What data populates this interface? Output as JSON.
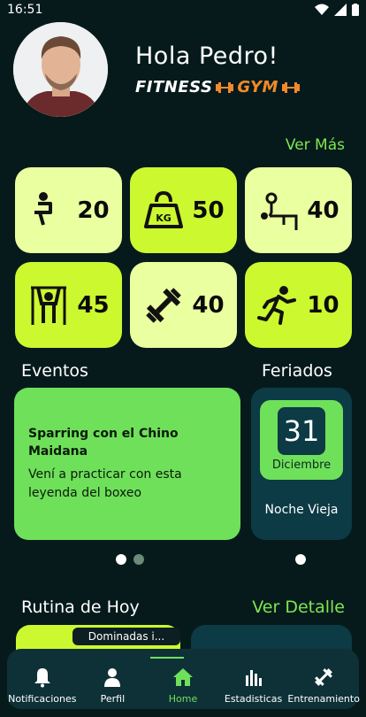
{
  "status_bar": {
    "time": "16:51"
  },
  "header": {
    "greeting": "Hola Pedro!",
    "brand_fitness": "FITNESS",
    "brand_gym": "GYM"
  },
  "stats": {
    "see_more": "Ver Más",
    "items": [
      {
        "icon": "squat-icon",
        "value": "20"
      },
      {
        "icon": "kettlebell-kg-icon",
        "value": "50"
      },
      {
        "icon": "bench-press-icon",
        "value": "40"
      },
      {
        "icon": "pull-up-icon",
        "value": "45"
      },
      {
        "icon": "dumbbell-icon",
        "value": "40"
      },
      {
        "icon": "running-icon",
        "value": "10"
      }
    ]
  },
  "events": {
    "title": "Eventos",
    "card": {
      "title": "Sparring con el Chino Maidana",
      "description": "Vení a practicar con esta leyenda del boxeo"
    }
  },
  "holidays": {
    "title": "Feriados",
    "card": {
      "day": "31",
      "month": "Diciembre",
      "name": "Noche Vieja"
    }
  },
  "routine": {
    "title": "Rutina de Hoy",
    "detail_link": "Ver Detalle",
    "tag": "Dominadas i..."
  },
  "nav": {
    "items": [
      {
        "label": "Notificaciones",
        "icon": "bell-icon"
      },
      {
        "label": "Perfil",
        "icon": "person-icon"
      },
      {
        "label": "Home",
        "icon": "home-icon"
      },
      {
        "label": "Estadisticas",
        "icon": "bar-chart-icon"
      },
      {
        "label": "Entrenamiento",
        "icon": "dumbbell-icon"
      }
    ]
  },
  "colors": {
    "background": "#061a1c",
    "accent_green": "#6fe05a",
    "lime": "#ccf82f",
    "pale_lime": "#eaffa0",
    "brand_orange": "#f08a2a"
  }
}
